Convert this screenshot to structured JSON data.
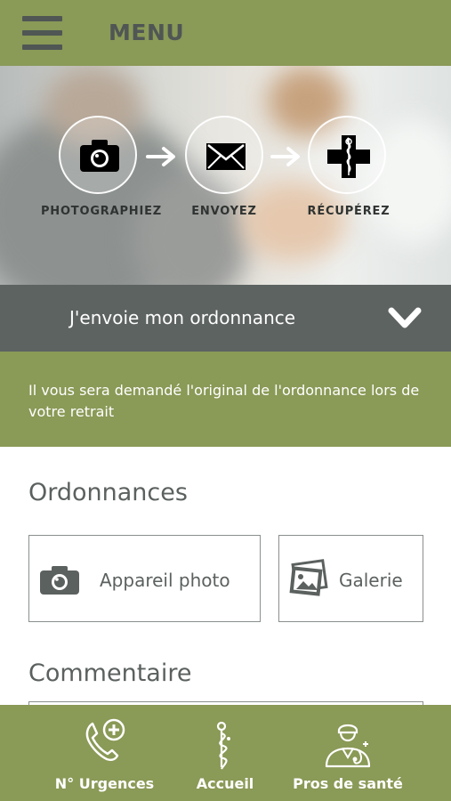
{
  "header": {
    "menu_title": "MENU"
  },
  "hero": {
    "steps": [
      {
        "label": "PHOTOGRAPHIEZ",
        "icon": "camera-icon"
      },
      {
        "label": "ENVOYEZ",
        "icon": "envelope-icon"
      },
      {
        "label": "RÉCUPÉREZ",
        "icon": "pharmacy-cross-icon"
      }
    ]
  },
  "send_bar": {
    "label": "J'envoie mon ordonnance",
    "icon": "chevron-down-icon"
  },
  "info": {
    "text": "Il vous sera demandé l'original de l'ordonnance lors de votre retrait"
  },
  "prescriptions": {
    "title": "Ordonnances",
    "camera_button": "Appareil photo",
    "gallery_button": "Galerie"
  },
  "comment": {
    "title": "Commentaire"
  },
  "bottom_nav": {
    "items": [
      {
        "label": "N° Urgences",
        "icon": "emergency-phone-icon"
      },
      {
        "label": "Accueil",
        "icon": "home-caduceus-icon"
      },
      {
        "label": "Pros de santé",
        "icon": "doctor-icon"
      }
    ]
  },
  "colors": {
    "olive": "#8a9a57",
    "dark_grey": "#5d6361",
    "text_grey": "#5b615f"
  }
}
